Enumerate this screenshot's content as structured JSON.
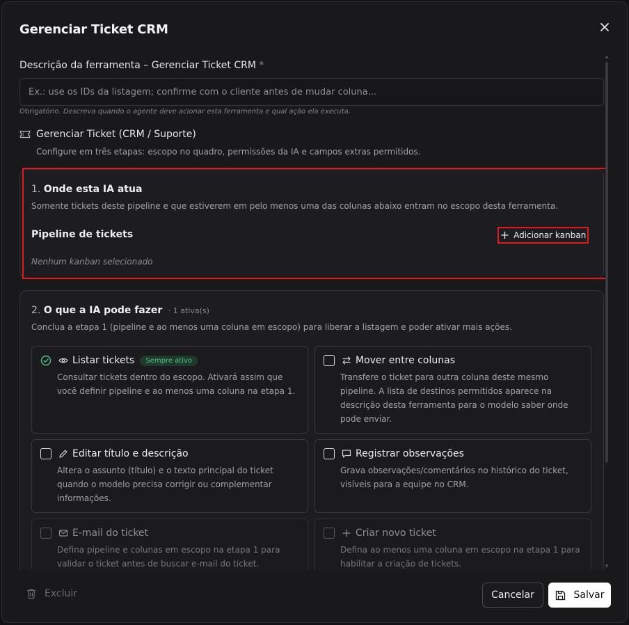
{
  "modal": {
    "title": "Gerenciar Ticket CRM",
    "close_icon": "close-icon"
  },
  "description_field": {
    "label": "Descrição da ferramenta – Gerenciar Ticket CRM",
    "required_mark": "*",
    "placeholder": "Ex.: use os IDs da listagem; confirme com o cliente antes de mudar coluna...",
    "value": "",
    "hint_prefix": "Obrigatório.",
    "hint_text": "Descreva quando o agente deve acionar esta ferramenta e qual ação ela executa."
  },
  "tool": {
    "icon": "ticket-icon",
    "title": "Gerenciar Ticket (CRM / Suporte)",
    "subtitle": "Configure em três etapas: escopo no quadro, permissões da IA e campos extras permitidos."
  },
  "step1": {
    "number": "1.",
    "title": "Onde esta IA atua",
    "description": "Somente tickets deste pipeline e que estiverem em pelo menos uma das colunas abaixo entram no escopo desta ferramenta.",
    "pipeline_label": "Pipeline de tickets",
    "add_kanban_label": "Adicionar kanban",
    "empty_note": "Nenhum kanban selecionado"
  },
  "step2": {
    "number": "2.",
    "title": "O que a IA pode fazer",
    "count": "· 1 ativa(s)",
    "description": "Conclua a etapa 1 (pipeline e ao menos uma coluna em escopo) para liberar a listagem e poder ativar mais ações.",
    "options": [
      {
        "title": "Listar tickets",
        "badge": "Sempre ativo",
        "icon": "eye-icon",
        "description": "Consultar tickets dentro do escopo. Ativará assim que você definir pipeline e ao menos uma coluna na etapa 1."
      },
      {
        "title": "Mover entre colunas",
        "icon": "arrows-exchange-icon",
        "description": "Transfere o ticket para outra coluna deste mesmo pipeline. A lista de destinos permitidos aparece na descrição desta ferramenta para o modelo saber onde pode enviar."
      },
      {
        "title": "Editar título e descrição",
        "icon": "pencil-icon",
        "description": "Altera o assunto (título) e o texto principal do ticket quando o modelo precisa corrigir ou complementar informações."
      },
      {
        "title": "Registrar observações",
        "icon": "comment-icon",
        "description": "Grava observações/comentários no histórico do ticket, visíveis para a equipe no CRM."
      },
      {
        "title": "E-mail do ticket",
        "icon": "mail-icon",
        "description": "Defina pipeline e colunas em escopo na etapa 1 para validar o ticket antes de buscar e-mail do ticket."
      },
      {
        "title": "Criar novo ticket",
        "icon": "plus-icon",
        "description": "Defina ao menos uma coluna em escopo na etapa 1 para habilitar a criação de tickets."
      }
    ]
  },
  "footer": {
    "delete_label": "Excluir",
    "cancel_label": "Cancelar",
    "save_label": "Salvar"
  },
  "colors": {
    "background": "#19191c",
    "highlight": "#e01b1b",
    "success": "#4cc38a"
  }
}
